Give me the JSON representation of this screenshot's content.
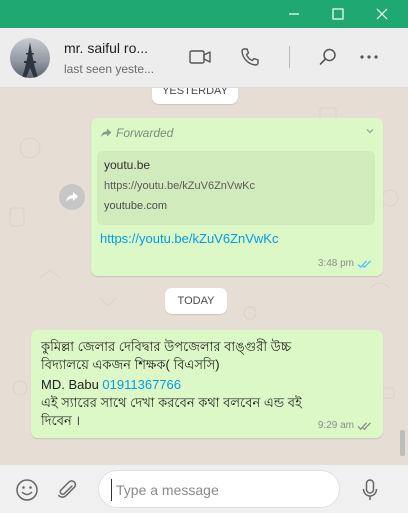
{
  "window": {
    "minimize_label": "—",
    "maximize_label": "☐",
    "close_label": "✕"
  },
  "header": {
    "contact_name": "mr. saiful ro...",
    "status": "last seen yeste...",
    "icons": [
      "video-camera-icon",
      "phone-icon",
      "search-icon",
      "more-icon"
    ]
  },
  "chat": {
    "date_yesterday": "YESTERDAY",
    "date_today": "TODAY",
    "message1": {
      "forwarded_label": "Forwarded",
      "preview_domain": "youtu.be",
      "preview_url": "https://youtu.be/kZuV6ZnVwKc",
      "preview_site": "youtube.com",
      "link_text": "https://youtu.be/kZuV6ZnVwKc",
      "time": "3:48 pm"
    },
    "message2": {
      "line1": "কুমিল্লা জেলার দেবিদ্বার উপজেলার বাঙ্গুরী উচ্চ",
      "line2": "বিদ্যালয়ে একজন শিক্ষক( বিএসসি)",
      "name_prefix": "MD. Babu ",
      "phone": "01911367766",
      "line4": "এই স্যারের সাথে দেখা করবেন কথা বলবেন এন্ড বই",
      "line5": "দিবেন ।",
      "time": "9:29 am"
    }
  },
  "composer": {
    "placeholder": "Type a message"
  },
  "colors": {
    "titlebar": "#1fa870",
    "bubble_out": "#dcf8c6",
    "link": "#039be5",
    "read_ticks": "#4fc3f7"
  }
}
